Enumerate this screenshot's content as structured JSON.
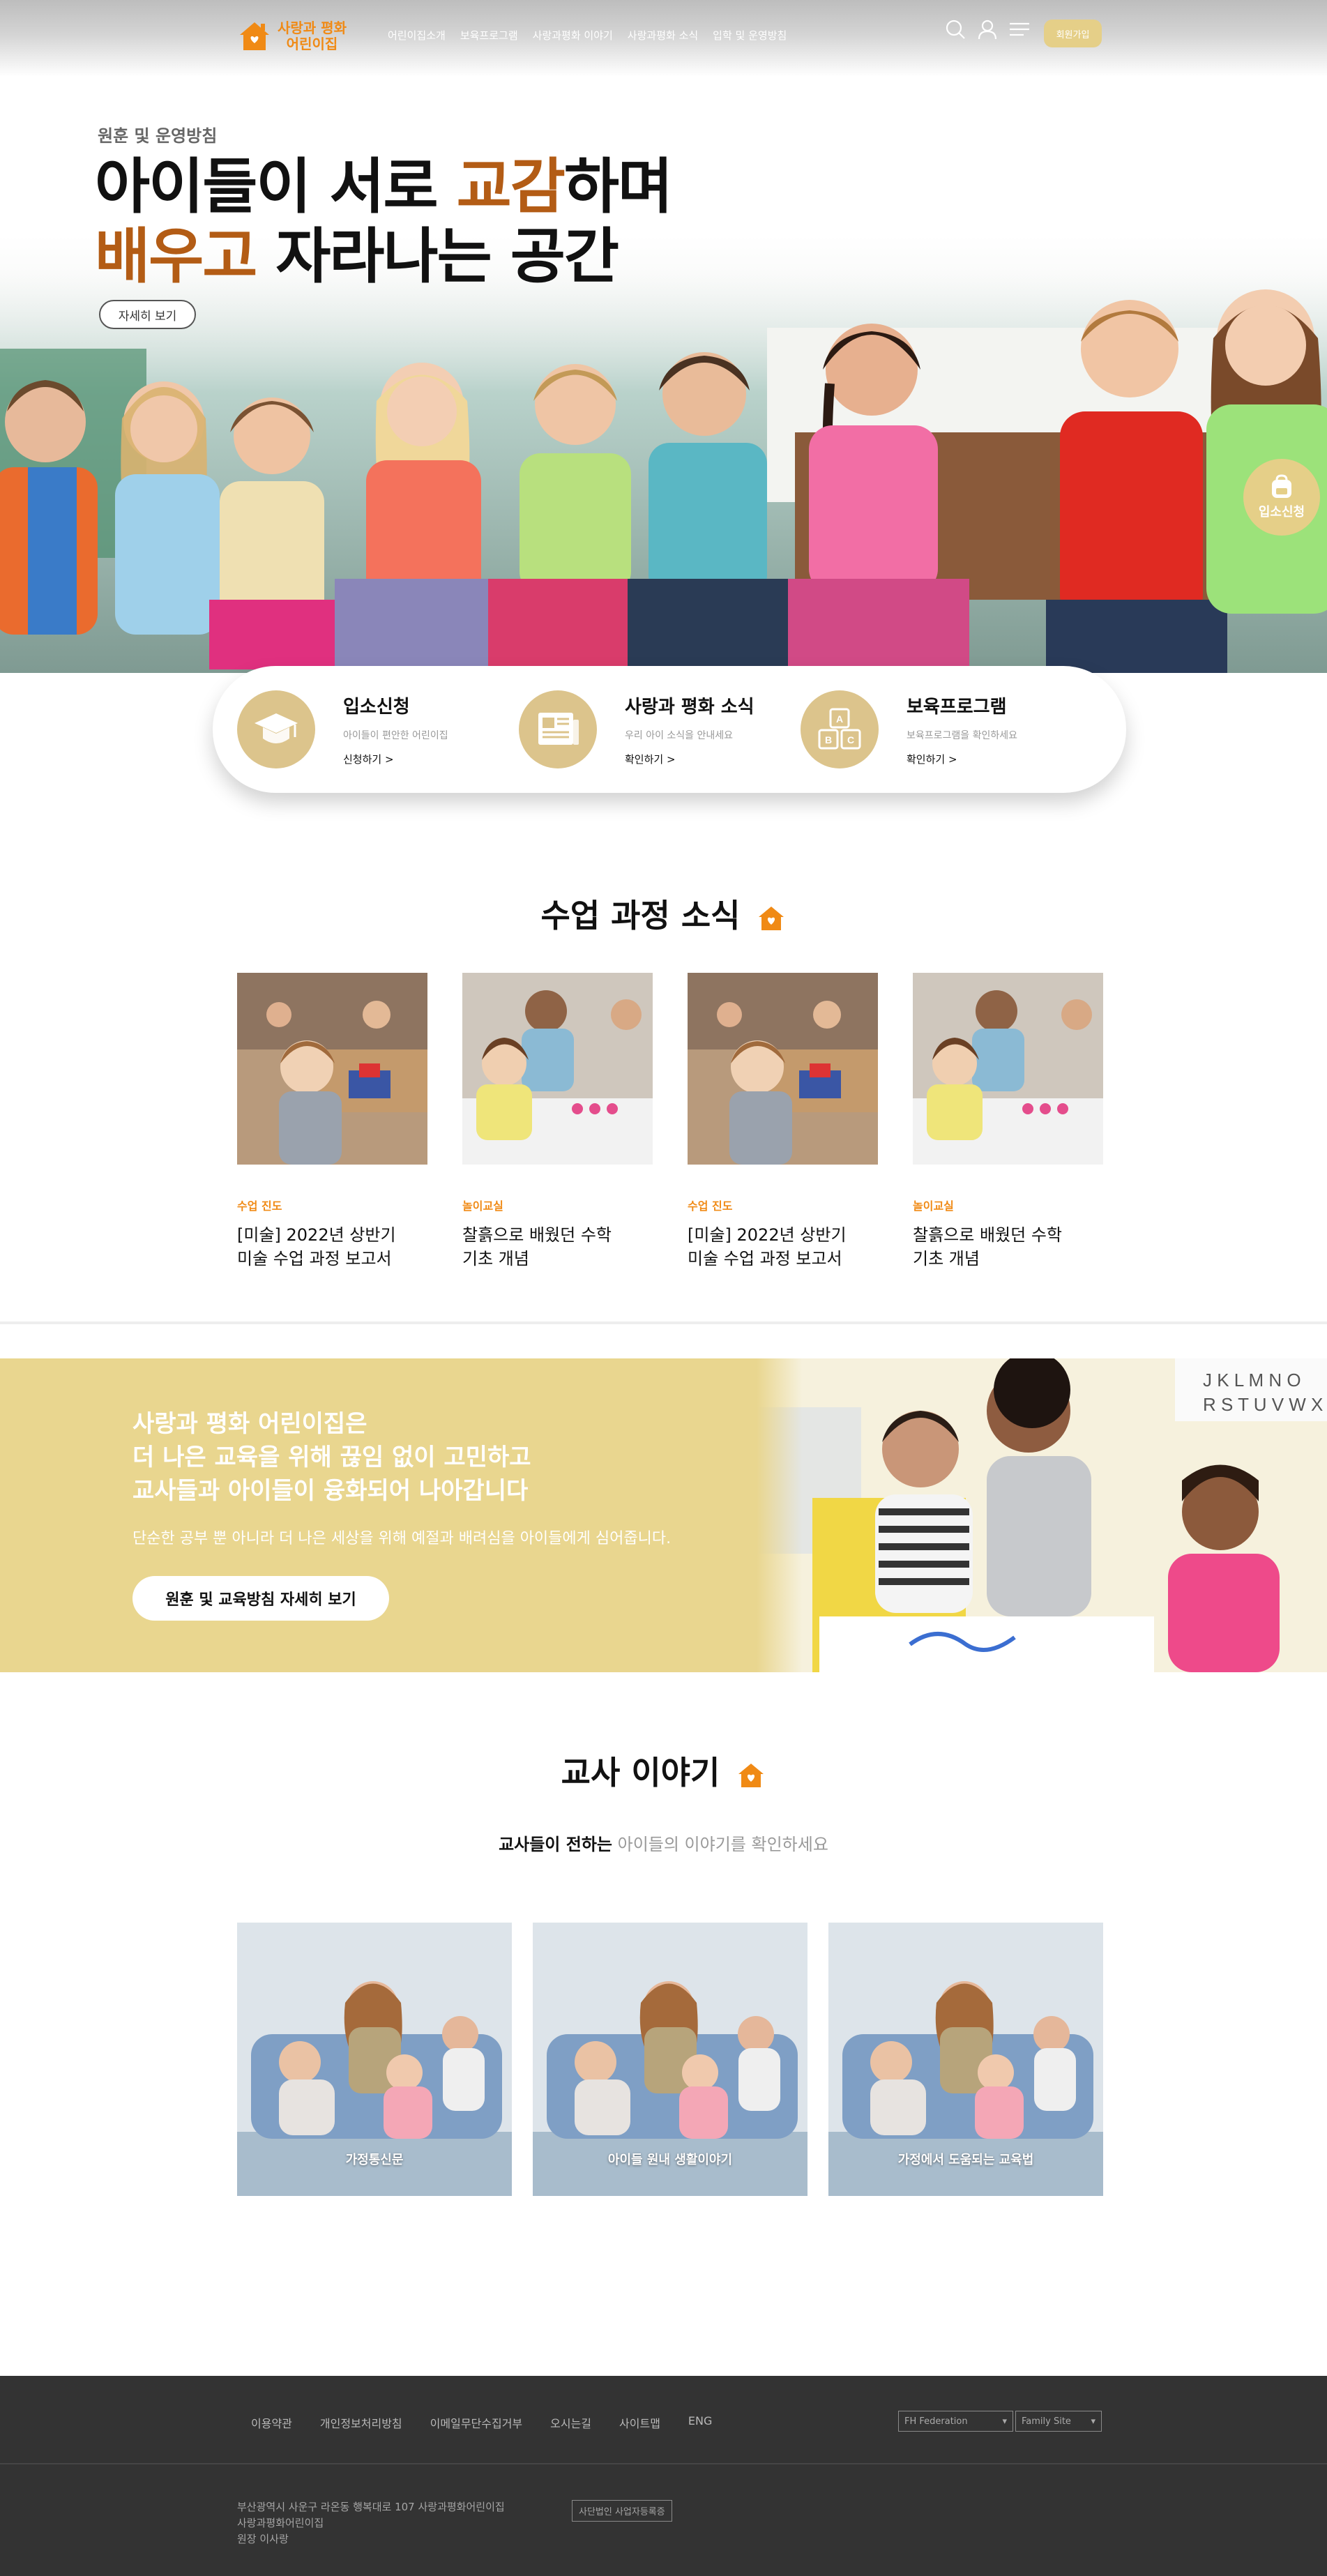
{
  "header": {
    "logo_line1": "사랑과 평화",
    "logo_line2": "어린이집",
    "nav": [
      "어린이집소개",
      "보육프로그램",
      "사랑과평화 이야기",
      "사랑과평화 소식",
      "입학 및 운영방침"
    ],
    "join_label": "회원가입"
  },
  "hero": {
    "subtitle": "원훈 및 운영방침",
    "line1_pre": "아이들이 서로 ",
    "line1_accent": "교감",
    "line1_post": "하며",
    "line2_accent": "배우고",
    "line2_post": " 자라나는 공간",
    "more_label": "자세히 보기",
    "float_label": "입소신청"
  },
  "quick": [
    {
      "title": "입소신청",
      "desc": "아이들이 편안한 어린이집",
      "link": "신청하기 >",
      "icon": "graduation-cap-icon"
    },
    {
      "title": "사랑과 평화 소식",
      "desc": "우리 아이 소식을 안내세요",
      "link": "확인하기 >",
      "icon": "newspaper-icon"
    },
    {
      "title": "보육프로그램",
      "desc": "보육프로그램을 확인하세요",
      "link": "확인하기 >",
      "icon": "abc-blocks-icon"
    }
  ],
  "course": {
    "title": "수업 과정 소식",
    "items": [
      {
        "category": "수업 진도",
        "title1": "[미술] 2022년 상반기",
        "title2": "미술 수업 과정 보고서"
      },
      {
        "category": "놀이교실",
        "title1": "찰흙으로 배웠던 수학",
        "title2": "기초 개념"
      },
      {
        "category": "수업 진도",
        "title1": "[미술] 2022년 상반기",
        "title2": "미술 수업 과정 보고서"
      },
      {
        "category": "놀이교실",
        "title1": "찰흙으로 배웠던 수학",
        "title2": "기초 개념"
      }
    ]
  },
  "banner": {
    "line1": "사랑과 평화 어린이집은",
    "line2": "더 나은 교육을 위해 끊임 없이 고민하고",
    "line3": "교사들과 아이들이 융화되어 나아갑니다",
    "sub": "단순한 공부 뿐 아니라 더 나은 세상을 위해 예절과 배려심을 아이들에게 심어줍니다.",
    "button": "원훈 및 교육방침 자세히 보기"
  },
  "teacher": {
    "title": "교사 이야기",
    "sub_bold": "교사들이 전하는",
    "sub_rest": " 아이들의 이야기를 확인하세요",
    "stories": [
      {
        "label": "가정통신문"
      },
      {
        "label": "아이들 원내 생활이야기"
      },
      {
        "label": "가정에서 도움되는 교육법"
      }
    ]
  },
  "footer": {
    "links": [
      "이용약관",
      "개인정보처리방침",
      "이메일무단수집거부",
      "오시는길",
      "사이트맵",
      "ENG"
    ],
    "select1": "FH Federation",
    "select2": "Family Site",
    "addr1": "부산광역시 사운구 라온동 행복대로 107 사랑과평화어린이집",
    "addr2": "사랑과평화어린이집",
    "addr3": "원장 이사랑",
    "badge": "사단법인 사업자등록증"
  },
  "colors": {
    "accent_orange": "#f08a15",
    "hero_accent": "#b35c15",
    "gold": "#dcc48c",
    "banner": "#e9d68f",
    "footer": "#333333"
  }
}
